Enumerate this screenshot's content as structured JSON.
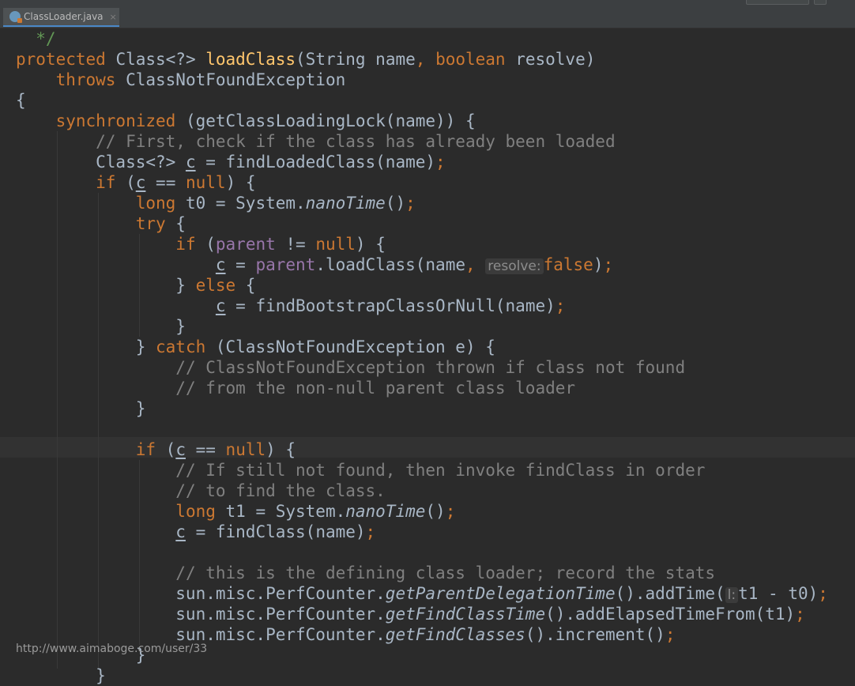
{
  "editor_tab": {
    "filename": "ClassLoader.java",
    "close_glyph": "×",
    "icon": "java-class-icon"
  },
  "code_lines": [
    [
      {
        "t": "  */",
        "c": "doc"
      }
    ],
    [
      {
        "t": "protected",
        "c": "kw"
      },
      {
        "t": " Class<?> "
      },
      {
        "t": "loadClass",
        "c": "fn"
      },
      {
        "t": "(String name"
      },
      {
        "t": ",",
        "c": "kw"
      },
      {
        "t": " "
      },
      {
        "t": "boolean",
        "c": "kw"
      },
      {
        "t": " resolve)"
      }
    ],
    [
      {
        "t": "    "
      },
      {
        "t": "throws",
        "c": "kw"
      },
      {
        "t": " ClassNotFoundException"
      }
    ],
    [
      {
        "t": "{"
      }
    ],
    [
      {
        "t": "    "
      },
      {
        "t": "synchronized",
        "c": "kw"
      },
      {
        "t": " (getClassLoadingLock(name)) {"
      }
    ],
    [
      {
        "t": "        "
      },
      {
        "t": "// First, check if the class has already been loaded",
        "c": "cm"
      }
    ],
    [
      {
        "t": "        Class<?> "
      },
      {
        "t": "c",
        "c": "ul"
      },
      {
        "t": " = findLoadedClass(name)"
      },
      {
        "t": ";",
        "c": "kw"
      }
    ],
    [
      {
        "t": "        "
      },
      {
        "t": "if",
        "c": "kw"
      },
      {
        "t": " ("
      },
      {
        "t": "c",
        "c": "ul"
      },
      {
        "t": " == "
      },
      {
        "t": "null",
        "c": "kw"
      },
      {
        "t": ") {"
      }
    ],
    [
      {
        "t": "            "
      },
      {
        "t": "long",
        "c": "kw"
      },
      {
        "t": " t0 = System."
      },
      {
        "t": "nanoTime",
        "c": "it"
      },
      {
        "t": "()"
      },
      {
        "t": ";",
        "c": "kw"
      }
    ],
    [
      {
        "t": "            "
      },
      {
        "t": "try",
        "c": "kw"
      },
      {
        "t": " {"
      }
    ],
    [
      {
        "t": "                "
      },
      {
        "t": "if",
        "c": "kw"
      },
      {
        "t": " ("
      },
      {
        "t": "parent",
        "c": "fld"
      },
      {
        "t": " != "
      },
      {
        "t": "null",
        "c": "kw"
      },
      {
        "t": ") {"
      }
    ],
    [
      {
        "t": "                    "
      },
      {
        "t": "c",
        "c": "ul"
      },
      {
        "t": " = "
      },
      {
        "t": "parent",
        "c": "fld"
      },
      {
        "t": ".loadClass(name"
      },
      {
        "t": ",",
        "c": "kw"
      },
      {
        "t": " "
      },
      {
        "t": "resolve:",
        "c": "hint"
      },
      {
        "t": "false",
        "c": "kw"
      },
      {
        "t": ")"
      },
      {
        "t": ";",
        "c": "kw"
      }
    ],
    [
      {
        "t": "                } "
      },
      {
        "t": "else",
        "c": "kw"
      },
      {
        "t": " {"
      }
    ],
    [
      {
        "t": "                    "
      },
      {
        "t": "c",
        "c": "ul"
      },
      {
        "t": " = findBootstrapClassOrNull(name)"
      },
      {
        "t": ";",
        "c": "kw"
      }
    ],
    [
      {
        "t": "                }"
      }
    ],
    [
      {
        "t": "            } "
      },
      {
        "t": "catch",
        "c": "kw"
      },
      {
        "t": " (ClassNotFoundException e) {"
      }
    ],
    [
      {
        "t": "                "
      },
      {
        "t": "// ClassNotFoundException thrown if class not found",
        "c": "cm"
      }
    ],
    [
      {
        "t": "                "
      },
      {
        "t": "// from the non-null parent class loader",
        "c": "cm"
      }
    ],
    [
      {
        "t": "            }"
      }
    ],
    [
      {
        "t": ""
      }
    ],
    [
      {
        "t": "            "
      },
      {
        "t": "if",
        "c": "kw"
      },
      {
        "t": " ("
      },
      {
        "t": "c",
        "c": "ul"
      },
      {
        "t": " == "
      },
      {
        "t": "null",
        "c": "kw"
      },
      {
        "t": ") {"
      }
    ],
    [
      {
        "t": "                "
      },
      {
        "t": "// If still not found, then invoke findClass in order",
        "c": "cm"
      }
    ],
    [
      {
        "t": "                "
      },
      {
        "t": "// to find the class.",
        "c": "cm"
      }
    ],
    [
      {
        "t": "                "
      },
      {
        "t": "long",
        "c": "kw"
      },
      {
        "t": " t1 = System."
      },
      {
        "t": "nanoTime",
        "c": "it"
      },
      {
        "t": "()"
      },
      {
        "t": ";",
        "c": "kw"
      }
    ],
    [
      {
        "t": "                "
      },
      {
        "t": "c",
        "c": "ul"
      },
      {
        "t": " = findClass(name)"
      },
      {
        "t": ";",
        "c": "kw"
      }
    ],
    [
      {
        "t": ""
      }
    ],
    [
      {
        "t": "                "
      },
      {
        "t": "// this is the defining class loader; record the stats",
        "c": "cm"
      }
    ],
    [
      {
        "t": "                sun.misc.PerfCounter."
      },
      {
        "t": "getParentDelegationTime",
        "c": "it"
      },
      {
        "t": "().addTime("
      },
      {
        "t": "l:",
        "c": "hint"
      },
      {
        "t": "t1 - t0)"
      },
      {
        "t": ";",
        "c": "kw"
      }
    ],
    [
      {
        "t": "                sun.misc.PerfCounter."
      },
      {
        "t": "getFindClassTime",
        "c": "it"
      },
      {
        "t": "().addElapsedTimeFrom(t1)"
      },
      {
        "t": ";",
        "c": "kw"
      }
    ],
    [
      {
        "t": "                sun.misc.PerfCounter."
      },
      {
        "t": "getFindClasses",
        "c": "it"
      },
      {
        "t": "().increment()"
      },
      {
        "t": ";",
        "c": "kw"
      }
    ],
    [
      {
        "t": "            }"
      }
    ],
    [
      {
        "t": "        }"
      }
    ]
  ],
  "watermark": "http://www.aimaboge.com/user/33",
  "colors": {
    "background": "#2b2b2b",
    "keyword": "#cc7832",
    "method_declaration": "#ffc66d",
    "comment": "#808080",
    "doc_comment": "#629755",
    "field": "#9876aa",
    "default_text": "#a9b7c6"
  }
}
